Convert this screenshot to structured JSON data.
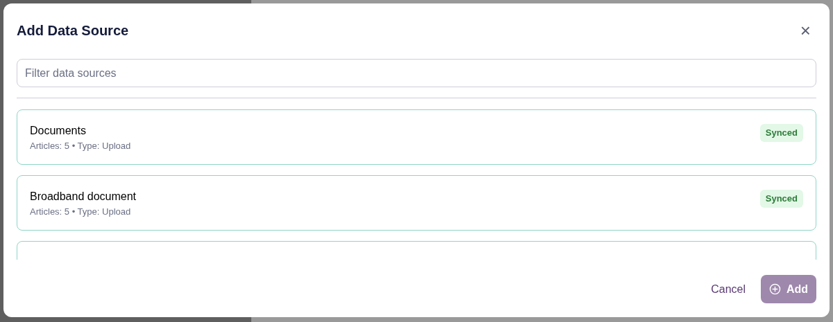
{
  "dialog": {
    "title": "Add Data Source",
    "close": "×"
  },
  "filter": {
    "placeholder": "Filter data sources"
  },
  "sources": [
    {
      "name": "Documents",
      "meta": "Articles: 5 • Type: Upload",
      "status": "Synced"
    },
    {
      "name": "Broadband document",
      "meta": "Articles: 5 • Type: Upload",
      "status": "Synced"
    }
  ],
  "footer": {
    "cancel": "Cancel",
    "add": {
      "label": "Add",
      "disabled": true
    }
  }
}
